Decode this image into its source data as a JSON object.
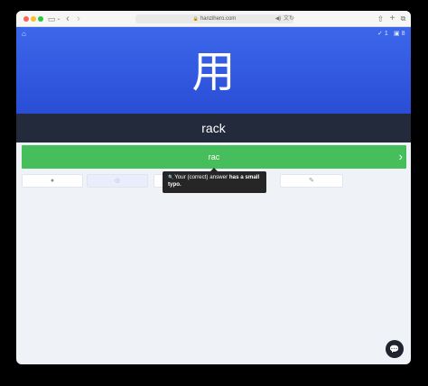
{
  "browser": {
    "url": "hanzihero.com",
    "icons": {
      "sidebar": "sidebar-icon",
      "back": "chevron-left-icon",
      "forward": "chevron-right-icon",
      "lock": "lock-icon",
      "audio": "speaker-icon",
      "translate": "translate-icon",
      "reload": "reload-icon",
      "share": "share-icon",
      "new_tab": "plus-icon",
      "tabs": "tabs-icon"
    }
  },
  "header": {
    "correct_count": "1",
    "review_count": "8"
  },
  "card": {
    "character": "用",
    "prompt": "rack"
  },
  "answer": {
    "value": "rac"
  },
  "tooltip": {
    "part1": "Your (correct) answer ",
    "part2": "has a small typo."
  },
  "colors": {
    "hero": "#2e54dc",
    "prompt_bar": "#222a3b",
    "answer_correct": "#46be5c",
    "background": "#eff3f8"
  }
}
